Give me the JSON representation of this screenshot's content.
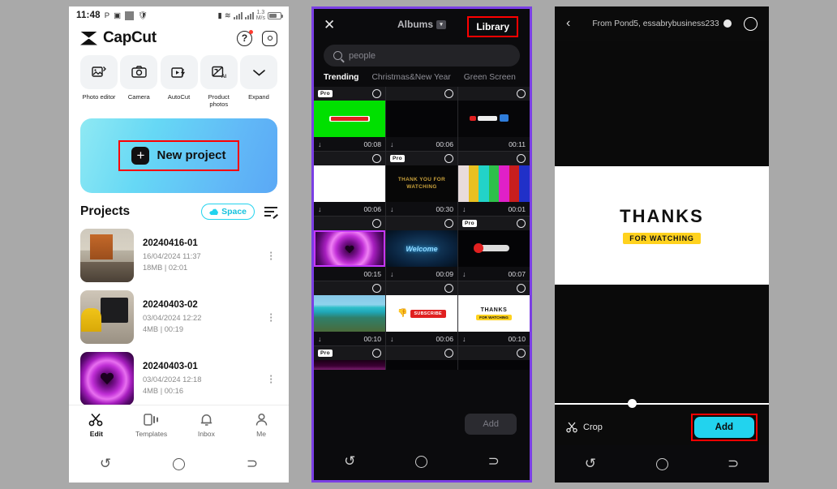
{
  "home": {
    "statusbar": {
      "time": "11:48",
      "icons": [
        "P",
        "app-icon",
        "square-icon",
        "shield-icon"
      ],
      "netspeed_value": "1.3",
      "netspeed_unit": "M/s"
    },
    "brand": "CapCut",
    "help_icon": "question-mark-icon",
    "settings_icon": "gear-icon",
    "tools": [
      {
        "label": "Photo editor",
        "icon": "photo-editor-icon"
      },
      {
        "label": "Camera",
        "icon": "camera-icon"
      },
      {
        "label": "AutoCut",
        "icon": "autocut-icon"
      },
      {
        "label": "Product photos",
        "icon": "product-photos-ai-icon"
      },
      {
        "label": "Expand",
        "icon": "chevron-down-icon"
      }
    ],
    "new_project": {
      "label": "New project",
      "plus": "+"
    },
    "projects_header": {
      "title": "Projects",
      "space_label": "Space",
      "cloud_icon": "cloud-icon",
      "sort_icon": "sort-edit-icon"
    },
    "projects": [
      {
        "title": "20240416-01",
        "date": "16/04/2024 11:37",
        "size": "18MB",
        "sep": "|",
        "duration": "02:01",
        "thumb": "th-room"
      },
      {
        "title": "20240403-02",
        "date": "03/04/2024 12:22",
        "size": "4MB",
        "sep": "|",
        "duration": "00:19",
        "thumb": "th-desk"
      },
      {
        "title": "20240403-01",
        "date": "03/04/2024 12:18",
        "size": "4MB",
        "sep": "|",
        "duration": "00:16",
        "thumb": "th-heart"
      }
    ],
    "bottom_nav": [
      {
        "label": "Edit",
        "icon": "scissors-icon",
        "active": true
      },
      {
        "label": "Templates",
        "icon": "templates-icon",
        "active": false
      },
      {
        "label": "Inbox",
        "icon": "bell-icon",
        "active": false
      },
      {
        "label": "Me",
        "icon": "person-icon",
        "active": false
      }
    ],
    "system_nav": [
      "recents-icon",
      "home-icon",
      "back-icon"
    ]
  },
  "library": {
    "close_icon": "close-x-icon",
    "albums_label": "Albums",
    "albums_chevron": "chevron-down-icon",
    "library_tab": "Library",
    "search_placeholder": "people",
    "search_icon": "search-icon",
    "tabs": [
      {
        "label": "Trending",
        "active": true
      },
      {
        "label": "Christmas&New Year",
        "active": false
      },
      {
        "label": "Green Screen",
        "active": false
      }
    ],
    "pro_badge": "Pro",
    "cells": [
      {
        "pro": true,
        "dl": true,
        "duration": "00:08",
        "style": "im-green",
        "selected": false
      },
      {
        "pro": false,
        "dl": true,
        "duration": "00:06",
        "style": "im-black",
        "selected": false
      },
      {
        "pro": false,
        "dl": false,
        "duration": "00:11",
        "style": "im-sub",
        "selected": false
      },
      {
        "pro": false,
        "dl": true,
        "duration": "00:06",
        "style": "im-white",
        "selected": false
      },
      {
        "pro": true,
        "dl": true,
        "duration": "00:30",
        "style": "im-thank",
        "selected": false,
        "text": "THANK YOU FOR WATCHING"
      },
      {
        "pro": false,
        "dl": true,
        "duration": "00:01",
        "style": "im-bars",
        "selected": false
      },
      {
        "pro": false,
        "dl": false,
        "duration": "00:15",
        "style": "im-heart",
        "selected": true
      },
      {
        "pro": false,
        "dl": true,
        "duration": "00:09",
        "style": "im-welcome",
        "selected": false,
        "text": "Welcome"
      },
      {
        "pro": true,
        "dl": true,
        "duration": "00:07",
        "style": "im-like",
        "selected": false
      },
      {
        "pro": false,
        "dl": true,
        "duration": "00:10",
        "style": "im-beach",
        "selected": false
      },
      {
        "pro": false,
        "dl": true,
        "duration": "00:06",
        "style": "im-subscribe",
        "selected": false,
        "text": "SUBSCRIBE"
      },
      {
        "pro": false,
        "dl": true,
        "duration": "00:10",
        "style": "im-thanks2",
        "selected": false,
        "text": "THANKS",
        "text2": "FOR WATCHING"
      },
      {
        "pro": true,
        "dl": false,
        "duration": "",
        "style": "im-dark-pink",
        "selected": false
      },
      {
        "pro": false,
        "dl": false,
        "duration": "",
        "style": "im-black",
        "selected": false
      },
      {
        "pro": false,
        "dl": false,
        "duration": "",
        "style": "im-black",
        "selected": false
      }
    ],
    "add_label": "Add",
    "system_nav": [
      "recents-icon",
      "home-icon",
      "back-icon"
    ]
  },
  "preview": {
    "back_icon": "chevron-left-icon",
    "title": "From Pond5, essabrybusiness233",
    "avatar_icon": "avatar-icon",
    "select_icon": "select-circle-icon",
    "canvas": {
      "line1": "THANKS",
      "line2": "FOR WATCHING"
    },
    "slider_position_pct": 36,
    "crop_label": "Crop",
    "crop_icon": "scissors-icon",
    "add_label": "Add",
    "system_nav": [
      "recents-icon",
      "home-icon",
      "back-icon"
    ]
  },
  "colors": {
    "accent_cyan": "#22d3ee",
    "highlight_red": "#ff0000",
    "panel_border_purple": "#7b3fe4",
    "background_gray": "#a9a9a9",
    "badge_yellow": "#ffd21e"
  }
}
